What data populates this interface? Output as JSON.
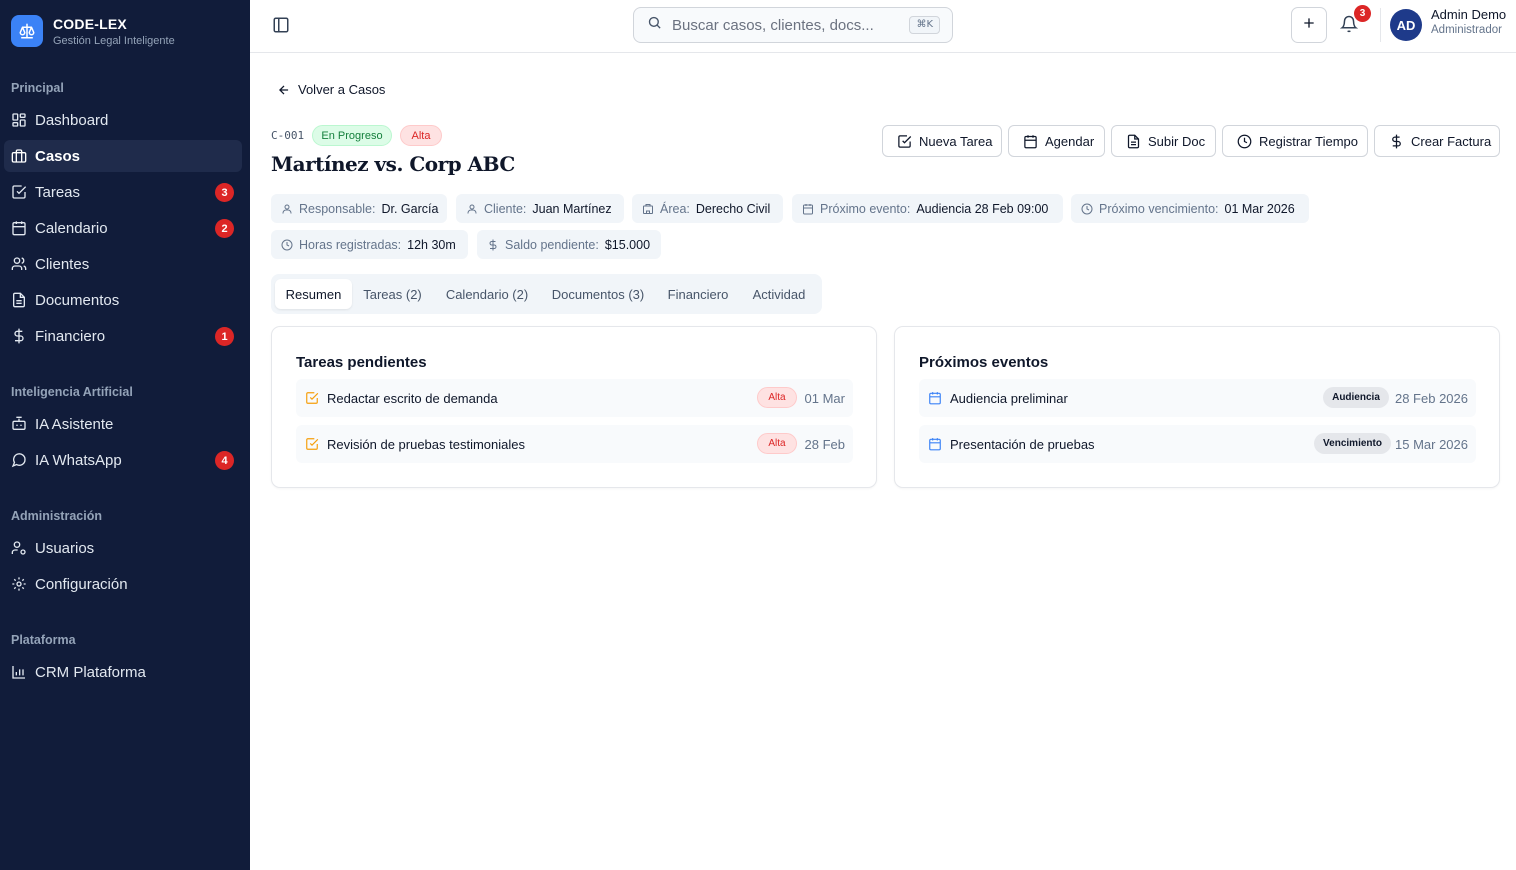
{
  "brand": {
    "name": "CODE-LEX",
    "subtitle": "Gestión Legal Inteligente"
  },
  "sidebar": {
    "sections": [
      {
        "title": "Principal"
      },
      {
        "title": "Inteligencia Artificial"
      },
      {
        "title": "Administración"
      },
      {
        "title": "Plataforma"
      }
    ],
    "items": [
      {
        "label": "Dashboard",
        "icon": "grid-icon"
      },
      {
        "label": "Casos",
        "icon": "briefcase-icon",
        "active": true
      },
      {
        "label": "Tareas",
        "icon": "check-square-icon",
        "badge": "3"
      },
      {
        "label": "Calendario",
        "icon": "calendar-icon",
        "badge": "2"
      },
      {
        "label": "Clientes",
        "icon": "users-icon"
      },
      {
        "label": "Documentos",
        "icon": "document-icon"
      },
      {
        "label": "Financiero",
        "icon": "dollar-icon",
        "badge": "1"
      },
      {
        "label": "IA Asistente",
        "icon": "bot-icon"
      },
      {
        "label": "IA WhatsApp",
        "icon": "chat-icon",
        "badge": "4"
      },
      {
        "label": "Usuarios",
        "icon": "user-cog-icon"
      },
      {
        "label": "Configuración",
        "icon": "gear-icon"
      },
      {
        "label": "CRM Plataforma",
        "icon": "bar-chart-icon"
      }
    ]
  },
  "topbar": {
    "search_placeholder": "Buscar casos, clientes, docs...",
    "shortcut": "⌘K",
    "notifications_count": "3",
    "user": {
      "initials": "AD",
      "name": "Admin Demo",
      "role": "Administrador"
    }
  },
  "case": {
    "back_label": "Volver a Casos",
    "id": "C-001",
    "status": "En Progreso",
    "priority": "Alta",
    "title": "Martínez vs. Corp ABC",
    "actions": [
      "Nueva Tarea",
      "Agendar",
      "Subir Doc",
      "Registrar Tiempo",
      "Crear Factura"
    ],
    "meta": [
      {
        "label": "Responsable:",
        "value": "Dr. García"
      },
      {
        "label": "Cliente:",
        "value": "Juan Martínez"
      },
      {
        "label": "Área:",
        "value": "Derecho Civil"
      },
      {
        "label": "Próximo evento:",
        "value": "Audiencia 28 Feb 09:00"
      },
      {
        "label": "Próximo vencimiento:",
        "value": "01 Mar 2026"
      },
      {
        "label": "Horas registradas:",
        "value": "12h 30m"
      },
      {
        "label": "Saldo pendiente:",
        "value": "$15.000"
      }
    ],
    "tabs": [
      "Resumen",
      "Tareas (2)",
      "Calendario (2)",
      "Documentos (3)",
      "Financiero",
      "Actividad"
    ]
  },
  "tasks_card": {
    "title": "Tareas pendientes",
    "items": [
      {
        "label": "Redactar escrito de demanda",
        "tag": "Alta",
        "date": "01 Mar"
      },
      {
        "label": "Revisión de pruebas testimoniales",
        "tag": "Alta",
        "date": "28 Feb"
      }
    ]
  },
  "events_card": {
    "title": "Próximos eventos",
    "items": [
      {
        "label": "Audiencia preliminar",
        "tag": "Audiencia",
        "date": "28 Feb 2026"
      },
      {
        "label": "Presentación de pruebas",
        "tag": "Vencimiento",
        "date": "15 Mar 2026"
      }
    ]
  },
  "colors": {
    "sidebar_bg": "#111c3a",
    "accent": "#3b82f6",
    "badge": "#dc2626",
    "task_icon": "#f59e0b",
    "event_icon": "#3b82f6"
  }
}
